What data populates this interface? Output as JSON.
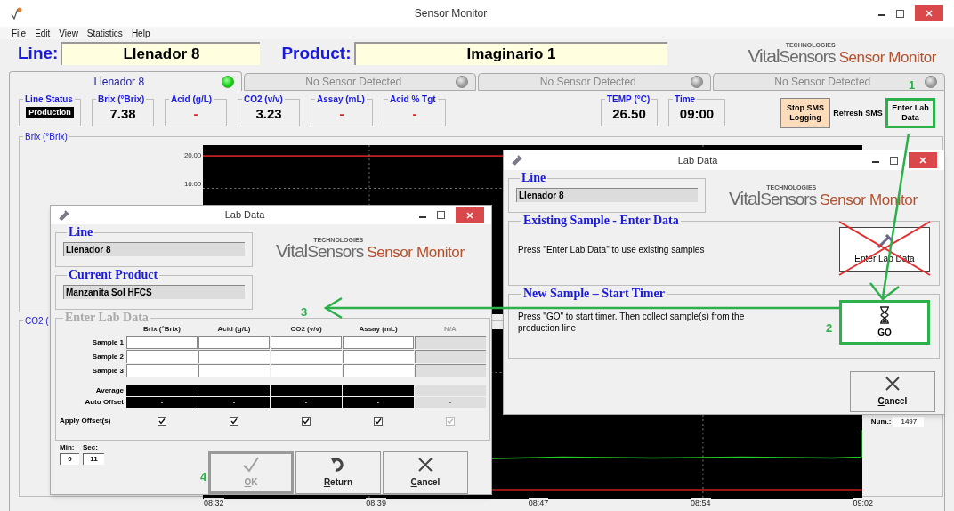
{
  "window": {
    "title": "Sensor Monitor"
  },
  "menu": [
    "File",
    "Edit",
    "View",
    "Statistics",
    "Help"
  ],
  "header": {
    "line_label": "Line:",
    "line_value": "Llenador 8",
    "product_label": "Product:",
    "product_value": "Imaginario 1",
    "logo": {
      "brand": "Vital",
      "brand2": "Sensors",
      "tag": "TECHNOLOGIES",
      "product": "Sensor Monitor"
    }
  },
  "tabs": [
    {
      "label": "Llenador 8",
      "selected": true,
      "sensor_on": true
    },
    {
      "label": "No Sensor Detected",
      "selected": false,
      "sensor_on": false
    },
    {
      "label": "No Sensor Detected",
      "selected": false,
      "sensor_on": false
    },
    {
      "label": "No Sensor Detected",
      "selected": false,
      "sensor_on": false
    }
  ],
  "readings": [
    {
      "label": "Line Status",
      "value": "Production",
      "kind": "status"
    },
    {
      "label": "Brix (°Brix)",
      "value": "7.38",
      "kind": "value"
    },
    {
      "label": "Acid (g/L)",
      "value": "-",
      "kind": "missing"
    },
    {
      "label": "CO2 (v/v)",
      "value": "3.23",
      "kind": "value"
    },
    {
      "label": "Assay (mL)",
      "value": "-",
      "kind": "missing"
    },
    {
      "label": "Acid % Tgt",
      "value": "-",
      "kind": "missing"
    }
  ],
  "conditions": [
    {
      "label": "TEMP (°C)",
      "value": "26.50"
    },
    {
      "label": "Time",
      "value": "09:00"
    }
  ],
  "actions": [
    {
      "label": "Stop SMS Logging",
      "kind": "warning",
      "highlighted": false
    },
    {
      "label": "Refresh SMS",
      "kind": "plain",
      "highlighted": false
    },
    {
      "label": "Enter Lab Data",
      "kind": "plain",
      "highlighted": true
    }
  ],
  "charts": [
    {
      "title": "Brix (°Brix)",
      "y_labels": [
        "20.00",
        "16.00"
      ]
    },
    {
      "title": "CO2 (",
      "num_label": "Num.:",
      "num_value": "1497"
    }
  ],
  "time_axis": [
    "08:32",
    "08:39",
    "08:47",
    "08:54",
    "09:02"
  ],
  "lab_dialog": {
    "title": "Lab Data",
    "line_label": "Line",
    "line_value": "Llenador 8",
    "product_label": "Current Product",
    "product_value": "Manzanita Sol HFCS",
    "logo": {
      "brand": "Vital",
      "brand2": "Sensors",
      "tag": "TECHNOLOGIES",
      "product": "Sensor Monitor"
    },
    "entry_label": "Enter Lab Data",
    "columns": [
      {
        "label": "Brix (°Brix)",
        "disabled": false
      },
      {
        "label": "Acid (g/L)",
        "disabled": false
      },
      {
        "label": "CO2 (v/v)",
        "disabled": false
      },
      {
        "label": "Assay (mL)",
        "disabled": false
      },
      {
        "label": "N/A",
        "disabled": true
      }
    ],
    "samples": [
      "Sample 1",
      "Sample 2",
      "Sample 3"
    ],
    "average_label": "Average",
    "offset_label": "Auto Offset",
    "offsets": [
      "-",
      "-",
      "-",
      "-",
      "-"
    ],
    "apply_label": "Apply Offset(s)",
    "apply": [
      {
        "checked": true,
        "disabled": false
      },
      {
        "checked": true,
        "disabled": false
      },
      {
        "checked": true,
        "disabled": false
      },
      {
        "checked": true,
        "disabled": false
      },
      {
        "checked": true,
        "disabled": true
      }
    ],
    "timer": {
      "min_label": "Min:",
      "min_value": "0",
      "sec_label": "Sec:",
      "sec_value": "11"
    },
    "buttons": [
      {
        "label": "OK",
        "kind": "ok",
        "disabled": true,
        "highlighted": true
      },
      {
        "label": "Return",
        "kind": "return",
        "disabled": false,
        "highlighted": false
      },
      {
        "label": "Cancel",
        "kind": "cancel",
        "disabled": false,
        "highlighted": false
      }
    ]
  },
  "start_dialog": {
    "title": "Lab Data",
    "line_label": "Line",
    "line_value": "Llenador 8",
    "logo": {
      "brand": "Vital",
      "brand2": "Sensors",
      "tag": "TECHNOLOGIES",
      "product": "Sensor Monitor"
    },
    "sections": [
      {
        "heading": "Existing Sample - Enter Data",
        "text": "Press \"Enter Lab Data\" to use existing samples",
        "button": "Enter Lab Data",
        "kind": "enter",
        "crossed_out": true,
        "highlighted": false
      },
      {
        "heading": "New Sample – Start Timer",
        "text": "Press \"GO\" to start timer.  Then collect sample(s) from the production line",
        "button": "GO",
        "kind": "go",
        "crossed_out": false,
        "highlighted": true
      }
    ],
    "cancel": "Cancel"
  },
  "callouts": [
    "1",
    "2",
    "3",
    "4"
  ]
}
